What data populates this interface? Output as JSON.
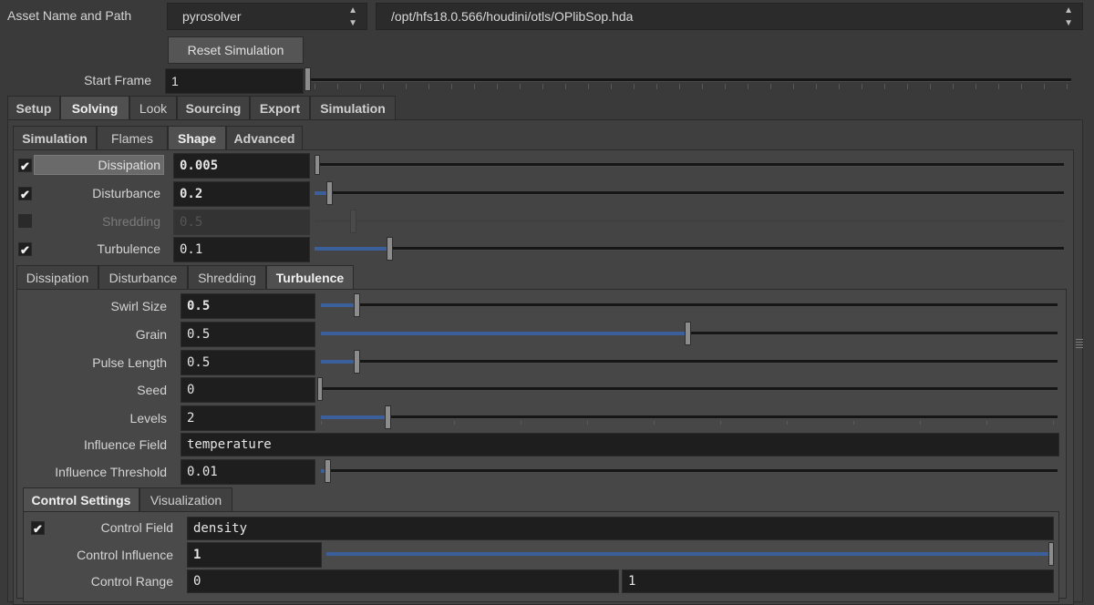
{
  "asset": {
    "label": "Asset Name and Path",
    "name": "pyrosolver",
    "path": "/opt/hfs18.0.566/houdini/otls/OPlibSop.hda"
  },
  "reset_button": "Reset Simulation",
  "start_frame": {
    "label": "Start Frame",
    "value": "1"
  },
  "main_tabs": [
    "Setup",
    "Solving",
    "Look",
    "Sourcing",
    "Export",
    "Simulation"
  ],
  "main_tabs_active": "Solving",
  "sub_tabs": [
    "Simulation",
    "Flames",
    "Shape",
    "Advanced"
  ],
  "sub_tabs_active": "Shape",
  "shape_params": [
    {
      "label": "Dissipation",
      "value": "0.005",
      "enabled": true,
      "level": 0.005
    },
    {
      "label": "Disturbance",
      "value": "0.2",
      "enabled": true,
      "level": 0.02
    },
    {
      "label": "Shredding",
      "value": "0.5",
      "enabled": false,
      "level": 0.05
    },
    {
      "label": "Turbulence",
      "value": "0.1",
      "enabled": true,
      "level": 0.1
    }
  ],
  "shape_tabs": [
    "Dissipation",
    "Disturbance",
    "Shredding",
    "Turbulence"
  ],
  "shape_tabs_active": "Turbulence",
  "turbulence": {
    "swirl_size": {
      "label": "Swirl Size",
      "value": "0.5"
    },
    "grain": {
      "label": "Grain",
      "value": "0.5"
    },
    "pulse_length": {
      "label": "Pulse Length",
      "value": "0.5"
    },
    "seed": {
      "label": "Seed",
      "value": "0"
    },
    "levels": {
      "label": "Levels",
      "value": "2"
    },
    "influence_field": {
      "label": "Influence Field",
      "value": "temperature"
    },
    "influence_threshold": {
      "label": "Influence Threshold",
      "value": "0.01"
    }
  },
  "control_tabs": [
    "Control Settings",
    "Visualization"
  ],
  "control_tabs_active": "Control Settings",
  "control": {
    "field": {
      "label": "Control Field",
      "value": "density"
    },
    "influence": {
      "label": "Control Influence",
      "value": "1"
    },
    "range": {
      "label": "Control Range",
      "min": "0",
      "max": "1"
    }
  },
  "colors": {
    "background": "#3a3a3a",
    "field": "#1e1e1e",
    "slider_fill": "#3a5f9a",
    "active_tab": "#505050"
  }
}
